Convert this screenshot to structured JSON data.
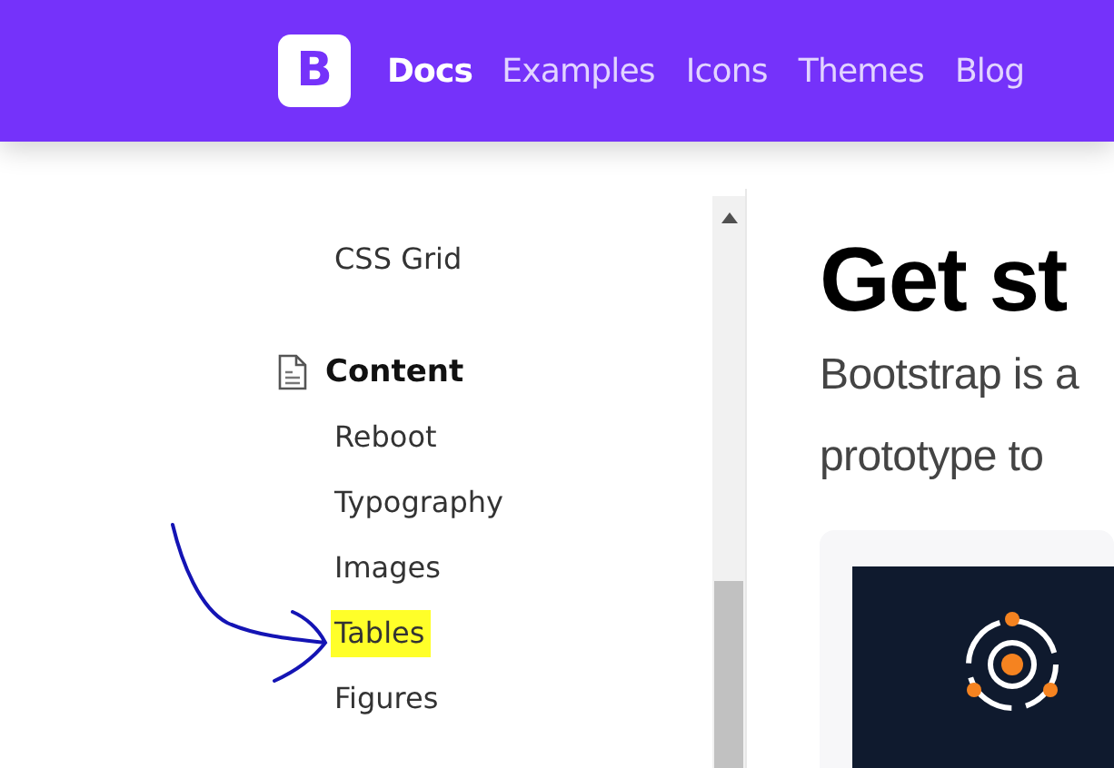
{
  "navbar": {
    "logo_letter": "B",
    "links": [
      {
        "label": "Docs",
        "selected": true
      },
      {
        "label": "Examples",
        "selected": false
      },
      {
        "label": "Icons",
        "selected": false
      },
      {
        "label": "Themes",
        "selected": false
      },
      {
        "label": "Blog",
        "selected": false
      }
    ]
  },
  "sidebar": {
    "sections": [
      {
        "items": [
          {
            "label": "CSS Grid",
            "highlighted": false
          }
        ]
      },
      {
        "title": "Content",
        "items": [
          {
            "label": "Reboot",
            "highlighted": false
          },
          {
            "label": "Typography",
            "highlighted": false
          },
          {
            "label": "Images",
            "highlighted": false
          },
          {
            "label": "Tables",
            "highlighted": true
          },
          {
            "label": "Figures",
            "highlighted": false
          }
        ]
      }
    ]
  },
  "main": {
    "heading": "Get st",
    "lead": [
      "Bootstrap is a",
      "prototype to"
    ]
  }
}
